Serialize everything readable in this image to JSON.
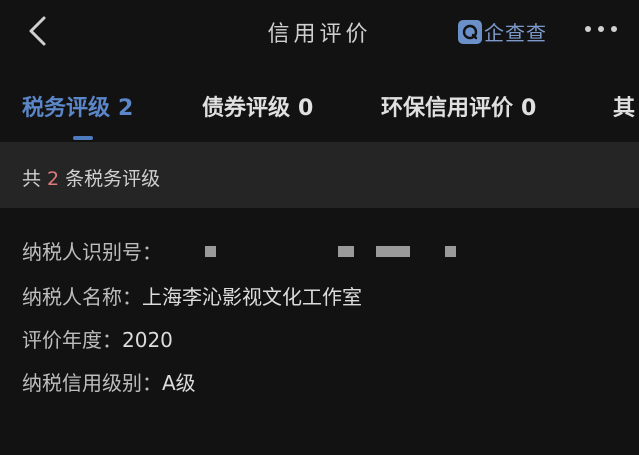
{
  "header": {
    "title": "信用评价",
    "brand": "企查查"
  },
  "tabs": [
    {
      "label": "税务评级",
      "count": "2"
    },
    {
      "label": "债券评级",
      "count": "0"
    },
    {
      "label": "环保信用评价",
      "count": "0"
    },
    {
      "label": "其",
      "count": ""
    }
  ],
  "summary": {
    "prefix": "共",
    "count": "2",
    "suffix": "条税务评级"
  },
  "record": {
    "taxpayer_id_label": "纳税人识别号：",
    "taxpayer_name_label": "纳税人名称：",
    "taxpayer_name": "上海李沁影视文化工作室",
    "year_label": "评价年度：",
    "year": "2020",
    "level_label": "纳税信用级别：",
    "level": "A级"
  },
  "colors": {
    "background": "#121212",
    "accent": "#5b86c8",
    "count_highlight": "#e07b7b",
    "section_bar": "#252525"
  }
}
